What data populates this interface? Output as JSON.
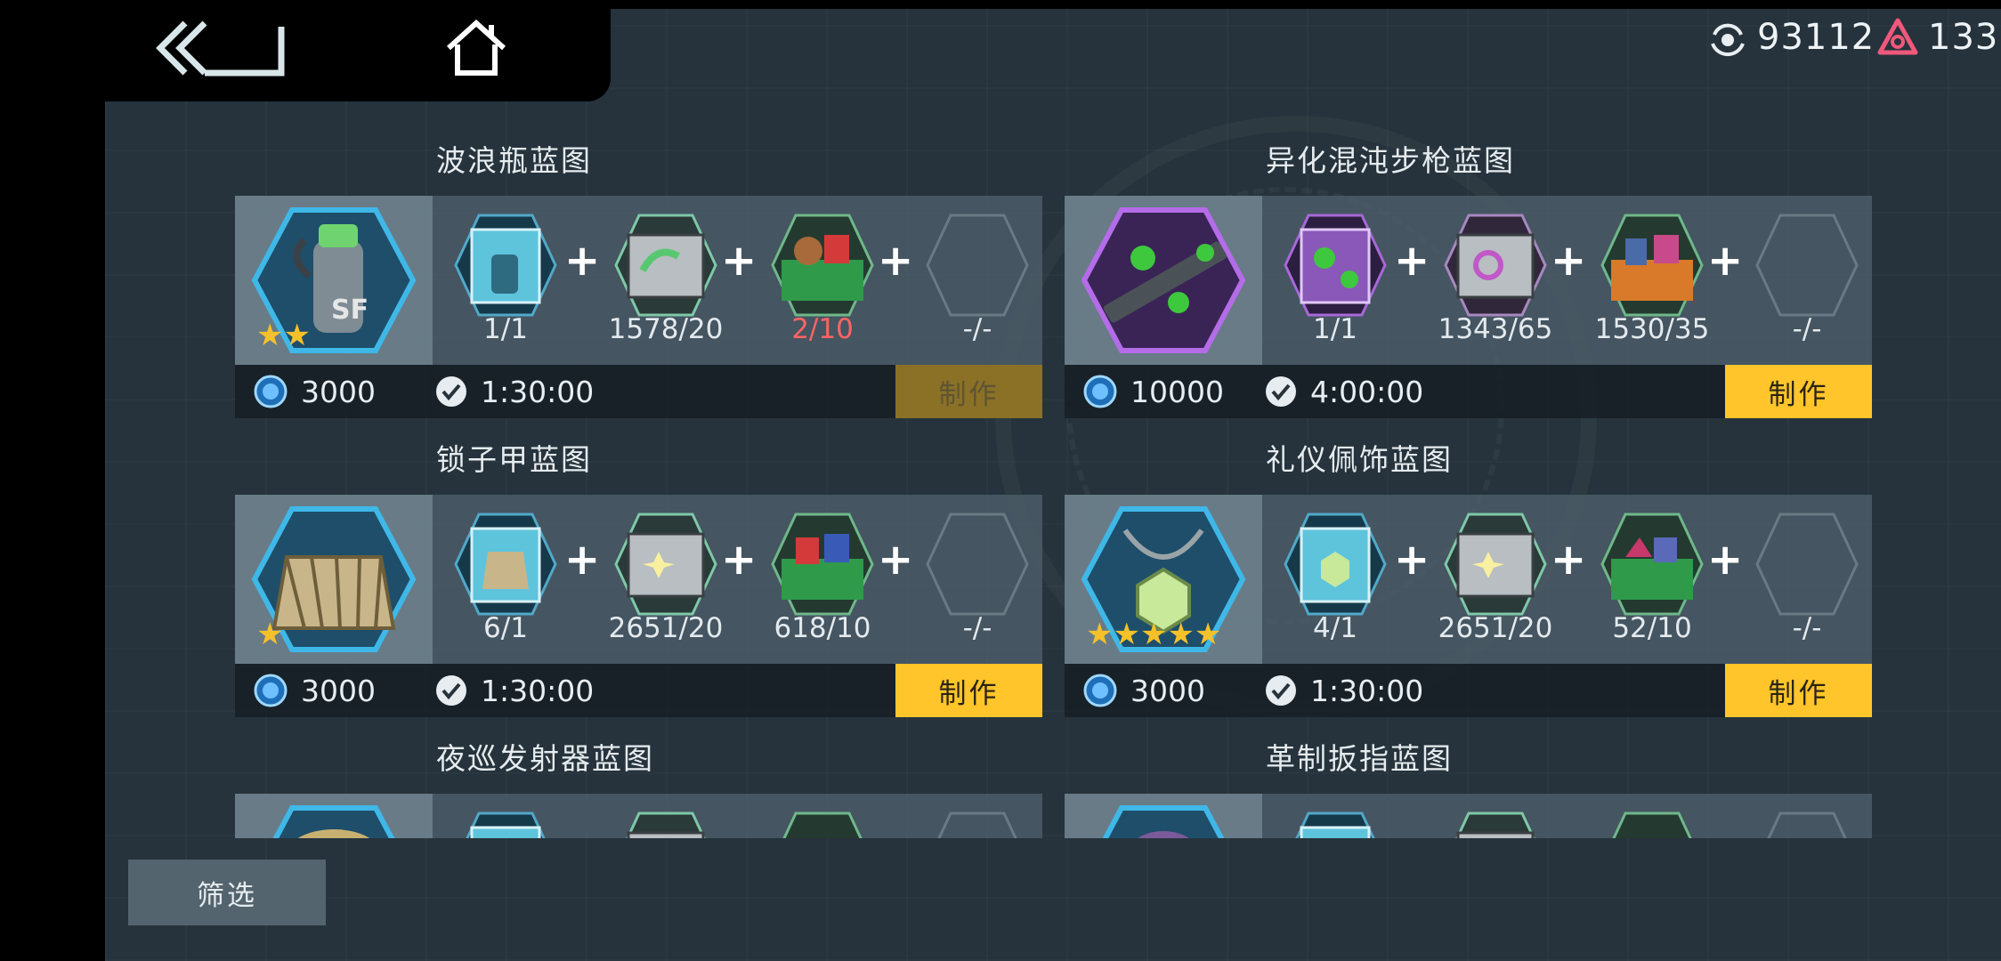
{
  "currency": {
    "coins": "93112",
    "gems": "133"
  },
  "blueprints": [
    {
      "title": "波浪瓶蓝图",
      "stars": "★★",
      "materials": [
        "1/1",
        "1578/20",
        "2/10",
        "-/-"
      ],
      "cost": "3000",
      "time": "1:30:00",
      "craft_label": "制作"
    },
    {
      "title": "异化混沌步枪蓝图",
      "stars": "",
      "materials": [
        "1/1",
        "1343/65",
        "1530/35",
        "-/-"
      ],
      "cost": "10000",
      "time": "4:00:00",
      "craft_label": "制作"
    },
    {
      "title": "锁子甲蓝图",
      "stars": "★",
      "materials": [
        "6/1",
        "2651/20",
        "618/10",
        "-/-"
      ],
      "cost": "3000",
      "time": "1:30:00",
      "craft_label": "制作"
    },
    {
      "title": "礼仪佩饰蓝图",
      "stars": "★★★★★",
      "materials": [
        "4/1",
        "2651/20",
        "52/10",
        "-/-"
      ],
      "cost": "3000",
      "time": "1:30:00",
      "craft_label": "制作"
    },
    {
      "title": "夜巡发射器蓝图"
    },
    {
      "title": "革制扳指蓝图"
    }
  ],
  "filter_label": "筛选",
  "colors": {
    "craft_enabled": "#ffc52a",
    "craft_disabled": "#8a7126",
    "insufficient": "#ff6464"
  }
}
